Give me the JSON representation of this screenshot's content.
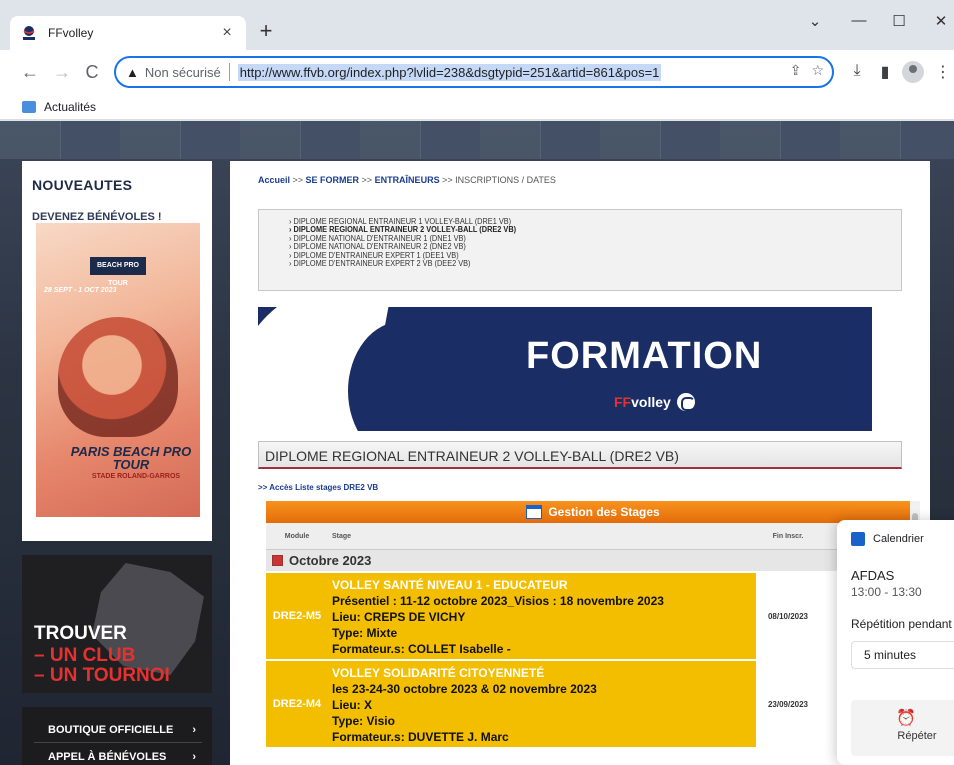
{
  "browser": {
    "tab_title": "FFvolley",
    "tab_close": "×",
    "new_tab": "+",
    "win_min": "—",
    "win_max": "☐",
    "win_close": "✕",
    "win_chevron": "⌄",
    "back": "←",
    "forward": "→",
    "reload": "C",
    "security_icon": "▲",
    "security_label": "Non sécurisé",
    "url": "http://www.ffvb.org/index.php?lvlid=238&dsgtypid=251&artid=861&pos=1",
    "share": "⇪",
    "star": "☆",
    "download": "⤓",
    "sidepanel": "▮",
    "menu": "⋮",
    "bookmark_label": "Actualités"
  },
  "sidebar": {
    "heading": "NOUVEAUTES",
    "subheading": "DEVENEZ BÉNÉVOLES !",
    "promo_brand": "BEACH PRO TOUR",
    "promo_date": "28 SEPT - 1 OCT 2023",
    "promo_title": "PARIS BEACH PRO TOUR",
    "promo_venue": "STADE ROLAND-GARROS",
    "trouver": "TROUVER",
    "trouver_l1": "– UN CLUB",
    "trouver_l2": "– UN TOURNOI",
    "menu": [
      {
        "label": "BOUTIQUE OFFICIELLE",
        "arrow": "›"
      },
      {
        "label": "APPEL À BÉNÉVOLES",
        "arrow": "›"
      }
    ]
  },
  "content": {
    "breadcrumb": {
      "home": "Accueil",
      "sep1": " >> ",
      "l1": "SE FORMER",
      "sep2": " >> ",
      "l2": "ENTRAÎNEURS",
      "sep3": " >> ",
      "current": "INSCRIPTIONS / DATES"
    },
    "diplomes": [
      "DIPLOME REGIONAL ENTRAINEUR 1 VOLLEY-BALL (DRE1 VB)",
      "DIPLOME REGIONAL ENTRAINEUR 2 VOLLEY-BALL (DRE2 VB)",
      "DIPLOME NATIONAL D'ENTRAINEUR 1 (DNE1 VB)",
      "DIPLOME NATIONAL D'ENTRAINEUR 2 (DNE2 VB)",
      "DIPLOME D'ENTRAINEUR EXPERT 1 (DEE1 VB)",
      "DIPLOME D'ENTRAINEUR EXPERT 2 VB (DEE2 VB)"
    ],
    "bullet": "›",
    "banner_title": "FORMATION",
    "banner_logo_ff": "FF",
    "banner_logo_rest": "volley",
    "diploma_title": "DIPLOME REGIONAL ENTRAINEUR 2 VOLLEY-BALL (DRE2 VB)",
    "acces_link": ">> Accès Liste stages DRE2 VB"
  },
  "stages": {
    "title": "Gestion des Stages",
    "col_module": "Module",
    "col_stage": "Stage",
    "col_fin": "Fin Inscr.",
    "month": "Octobre 2023",
    "rows": [
      {
        "code": "DRE2-M5",
        "name": "VOLLEY SANTÉ NIVEAU 1 - EDUCATEUR",
        "line1": "Présentiel : 11-12 octobre 2023_Visios : 18 novembre 2023",
        "lieu": "Lieu: CREPS DE VICHY",
        "type": "Type: Mixte",
        "formateur": "Formateur.s: COLLET Isabelle -",
        "fin": "08/10/2023"
      },
      {
        "code": "DRE2-M4",
        "name": "VOLLEY SOLIDARITÉ CITOYENNETÉ",
        "line1": "les 23-24-30 octobre 2023 & 02 novembre 2023",
        "lieu": "Lieu: X",
        "type": "Type: Visio",
        "formateur": "Formateur.s: DUVETTE J. Marc",
        "fin": "23/09/2023"
      }
    ]
  },
  "toast": {
    "app": "Calendrier",
    "title": "AFDAS",
    "time": "13:00 - 13:30",
    "repeat_label": "Répétition pendant",
    "repeat_value": "5 minutes",
    "action_icon": "⏰",
    "action_label": "Répéter"
  }
}
